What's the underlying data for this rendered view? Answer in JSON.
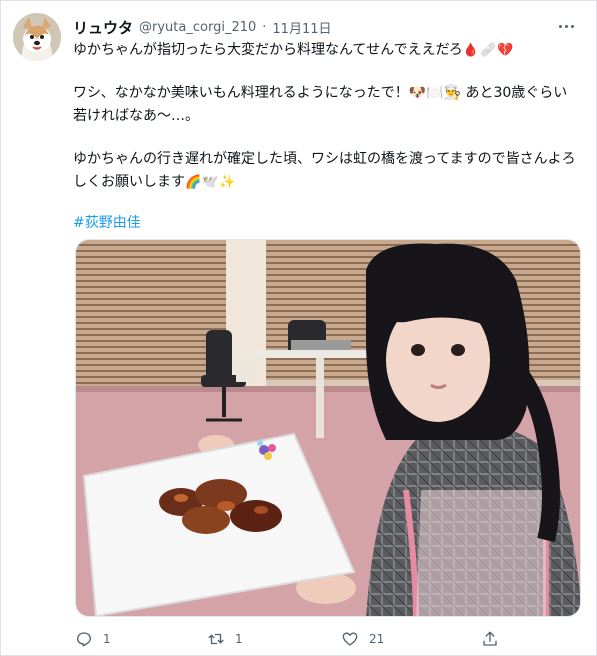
{
  "tweet": {
    "author_name": "リュウタ",
    "handle": "@ryuta_corgi_210",
    "separator": "·",
    "date": "11月11日",
    "paragraphs": [
      {
        "text": "ゆかちゃんが指切ったら大変だから料理なんてせんでええだろ",
        "emoji": "🩸🩹💔"
      },
      {
        "text": "ワシ、なかなか美味いもん料理れるようになったで！🐶🍽️👨‍🍳 あと30歳ぐらい若ければなあ〜…。",
        "emoji": ""
      },
      {
        "text": "ゆかちゃんの行き遅れが確定した頃、ワシは虹の橋を渡ってますので皆さんよろしくお願いします",
        "emoji": "🌈🕊️✨"
      }
    ],
    "hashtag": "#荻野由佳",
    "stats": {
      "replies": "1",
      "retweets": "1",
      "likes": "21"
    },
    "icons": {
      "avatar": "corgi-avatar",
      "more": "more-icon",
      "reply": "reply-icon",
      "retweet": "retweet-icon",
      "like": "heart-icon",
      "share": "share-icon"
    },
    "colors": {
      "link": "#1d9bf0",
      "muted": "#536471",
      "text": "#0f1419"
    }
  }
}
